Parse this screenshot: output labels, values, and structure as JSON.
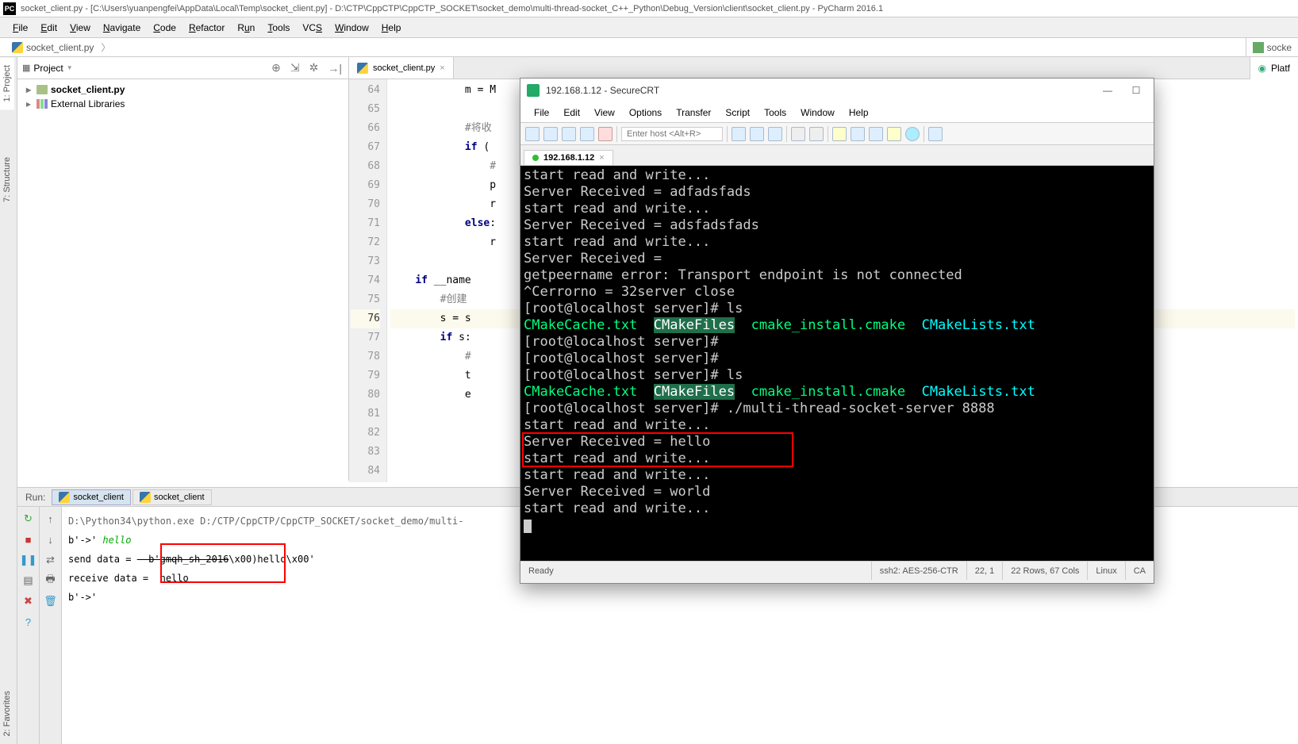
{
  "pycharm": {
    "title": "socket_client.py - [C:\\Users\\yuanpengfei\\AppData\\Local\\Temp\\socket_client.py] - D:\\CTP\\CppCTP\\CppCTP_SOCKET\\socket_demo\\multi-thread-socket_C++_Python\\Debug_Version\\client\\socket_client.py - PyCharm 2016.1",
    "menu": {
      "file": "File",
      "edit": "Edit",
      "view": "View",
      "navigate": "Navigate",
      "code": "Code",
      "refactor": "Refactor",
      "run": "Run",
      "tools": "Tools",
      "vcs": "VCS",
      "window": "Window",
      "help": "Help"
    },
    "breadcrumb": {
      "file": "socket_client.py",
      "right": "socke"
    },
    "vtabs": {
      "project": "1: Project",
      "structure": "7: Structure",
      "favorites": "2: Favorites"
    },
    "project_panel": {
      "title": "Project",
      "items": {
        "file": "socket_client.py",
        "libs": "External Libraries"
      }
    },
    "editor_tab": {
      "label": "socket_client.py"
    },
    "right_float": {
      "label": "Platf"
    },
    "gutter": [
      "64",
      "65",
      "66",
      "67",
      "68",
      "69",
      "70",
      "71",
      "72",
      "73",
      "74",
      "75",
      "76",
      "77",
      "78",
      "79",
      "80",
      "81",
      "82",
      "83",
      "84"
    ],
    "code": {
      "l64": "            m = M",
      "l66": "            #将收",
      "l67_pre": "            ",
      "l67_if": "if",
      "l67_post": " (",
      "l68": "                #",
      "l69": "                p",
      "l70": "                r",
      "l71_pre": "            ",
      "l71_else": "else",
      "l72": "                r",
      "l74_pre": "    ",
      "l74_if": "if",
      "l74_post": " __name",
      "l75": "        #创建",
      "l76": "        s = s",
      "l77_pre": "        ",
      "l77_if": "if",
      "l77_post": " s:",
      "l78": "            #",
      "l79": "            t",
      "l80": "            e",
      "l81": "",
      "l82": "",
      "l83": ""
    },
    "run": {
      "label": "Run:",
      "tab1": "socket_client",
      "tab2": "socket_client",
      "out": {
        "path": "D:\\Python34\\python.exe D:/CTP/CppCTP/CppCTP_SOCKET/socket_demo/multi-",
        "prompt1": "b'->'",
        "input1": "hello",
        "send_pre": "send data = ",
        "send_strike": "  b'gmqh_sh_2016",
        "send_post": "\\x00)hello\\x00'",
        "recv": "receive data =  hello",
        "prompt2": "b'->'"
      }
    }
  },
  "securecrt": {
    "title": "192.168.1.12 - SecureCRT",
    "menu": {
      "file": "File",
      "edit": "Edit",
      "view": "View",
      "options": "Options",
      "transfer": "Transfer",
      "script": "Script",
      "tools": "Tools",
      "window": "Window",
      "help": "Help"
    },
    "host_placeholder": "Enter host <Alt+R>",
    "tab": "192.168.1.12",
    "term": {
      "l1": "start read and write...",
      "l2": "Server Received = adfadsfads",
      "l3": "start read and write...",
      "l4": "Server Received = adsfadsfads",
      "l5": "start read and write...",
      "l6": "Server Received = ",
      "l7": "getpeername error: Transport endpoint is not connected",
      "l8": "^Cerrorno = 32server close",
      "l9": "[root@localhost server]# ls",
      "ls_a": "CMakeCache.txt",
      "ls_b": "CMakeFiles",
      "ls_c": "cmake_install.cmake",
      "ls_d": "CMakeLists.txt",
      "l11": "[root@localhost server]# ",
      "l12": "[root@localhost server]#",
      "l13": "[root@localhost server]# ls",
      "l15": "[root@localhost server]# ./multi-thread-socket-server 8888",
      "l16": "start read and write...",
      "l17": "Server Received = hello",
      "l18": "start read and write...",
      "l19": "start read and write...",
      "l20": "Server Received = world",
      "l21": "start read and write..."
    },
    "status": {
      "ready": "Ready",
      "enc": "ssh2: AES-256-CTR",
      "pos": "22,  1",
      "dims": "22 Rows, 67 Cols",
      "os": "Linux",
      "cap": "CA"
    }
  }
}
